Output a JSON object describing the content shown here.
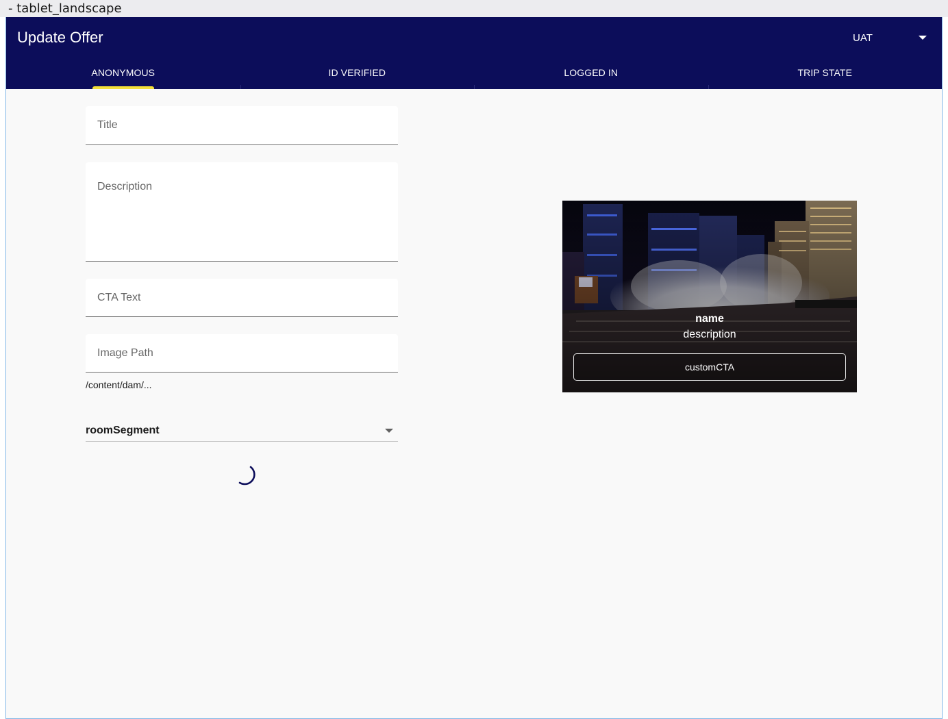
{
  "window": {
    "label": "- tablet_landscape"
  },
  "app_bar": {
    "title": "Update Offer",
    "environment": {
      "selected": "UAT",
      "icon": "chevron-down-icon"
    }
  },
  "tabs": [
    {
      "label": "ANONYMOUS",
      "active": true
    },
    {
      "label": "ID VERIFIED",
      "active": false
    },
    {
      "label": "LOGGED IN",
      "active": false
    },
    {
      "label": "TRIP STATE",
      "active": false
    }
  ],
  "form": {
    "title_label": "Title",
    "description_label": "Description",
    "cta_label": "CTA Text",
    "image_label": "Image Path",
    "image_helper": "/content/dam/...",
    "room_segment": {
      "selected": "roomSegment"
    }
  },
  "preview": {
    "name": "name",
    "description": "description",
    "cta": "customCTA"
  },
  "colors": {
    "app_bar": "#0c0d5a",
    "tab_indicator": "#f3e03a",
    "background": "#f9f9f9",
    "spinner": "#0c0d5a"
  }
}
